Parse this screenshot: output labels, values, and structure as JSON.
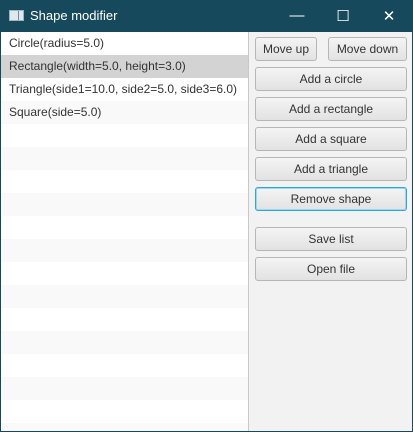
{
  "window": {
    "title": "Shape modifier",
    "minimize": "—",
    "maximize": "☐",
    "close": "✕"
  },
  "list": {
    "items": [
      {
        "label": "Circle(radius=5.0)",
        "selected": false
      },
      {
        "label": "Rectangle(width=5.0, height=3.0)",
        "selected": true
      },
      {
        "label": "Triangle(side1=10.0, side2=5.0, side3=6.0)",
        "selected": false
      },
      {
        "label": "Square(side=5.0)",
        "selected": false
      }
    ]
  },
  "buttons": {
    "move_up": "Move up",
    "move_down": "Move down",
    "add_circle": "Add a circle",
    "add_rectangle": "Add a rectangle",
    "add_square": "Add a square",
    "add_triangle": "Add a triangle",
    "remove_shape": "Remove shape",
    "save_list": "Save list",
    "open_file": "Open file"
  },
  "colors": {
    "titlebar": "#17495d",
    "selection": "#d3d3d3",
    "focus": "#2fa6dd"
  }
}
